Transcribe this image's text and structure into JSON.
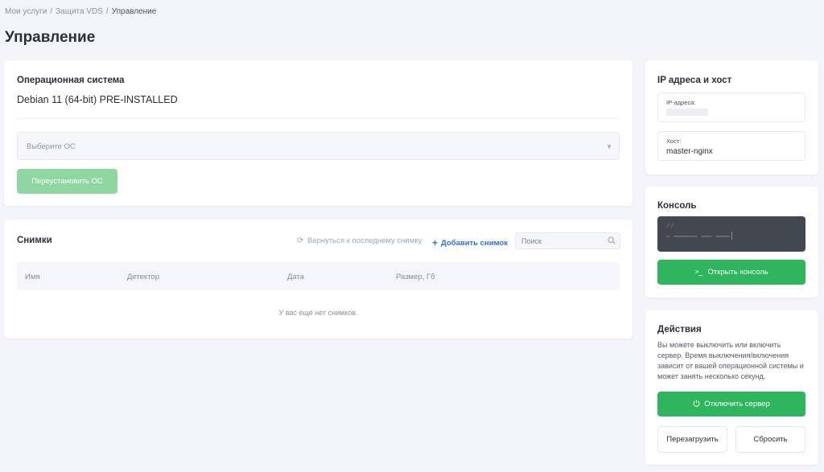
{
  "breadcrumb": {
    "items": [
      "Мои услуги",
      "Защита VDS"
    ],
    "current": "Управление",
    "separator": "/"
  },
  "page_title": "Управление",
  "os": {
    "title": "Операционная система",
    "current": "Debian 11 (64-bit) PRE-INSTALLED",
    "select_placeholder": "Выберите ОС",
    "reinstall_label": "Переустановить ОС"
  },
  "snapshots": {
    "title": "Снимки",
    "revert_label": "Вернуться к последнему снимку",
    "add_label": "Добавить снимок",
    "search_placeholder": "Поиск",
    "columns": [
      "Имя",
      "Детектор",
      "Дата",
      "Размер, Гб"
    ],
    "empty_message": "У вас еще нет снимков."
  },
  "ip_host": {
    "title": "IP адреса и хост",
    "ip_label": "IP-адреса:",
    "host_label": "Хост:",
    "host_value": "master-nginx"
  },
  "console": {
    "title": "Консоль",
    "prompt": "//",
    "open_label": "Открыть консоль"
  },
  "actions": {
    "title": "Действия",
    "description": "Вы можете выключить или включить сервер. Время выключения/включения зависит от вашей операционной системы и может занять несколько секунд.",
    "shutdown_label": "Отключить сервер",
    "reboot_label": "Перезагрузить",
    "reset_label": "Сбросить"
  },
  "colors": {
    "accent_green": "#2fb55d",
    "accent_green_disabled": "#8fd6a3",
    "link_blue": "#2f6fd6",
    "background": "#f4f5fa"
  },
  "icons": {
    "revert": "refresh-icon",
    "add": "plus-icon",
    "search": "search-icon",
    "dropdown": "chevron-down-icon",
    "console": "terminal-icon",
    "power": "power-icon"
  }
}
